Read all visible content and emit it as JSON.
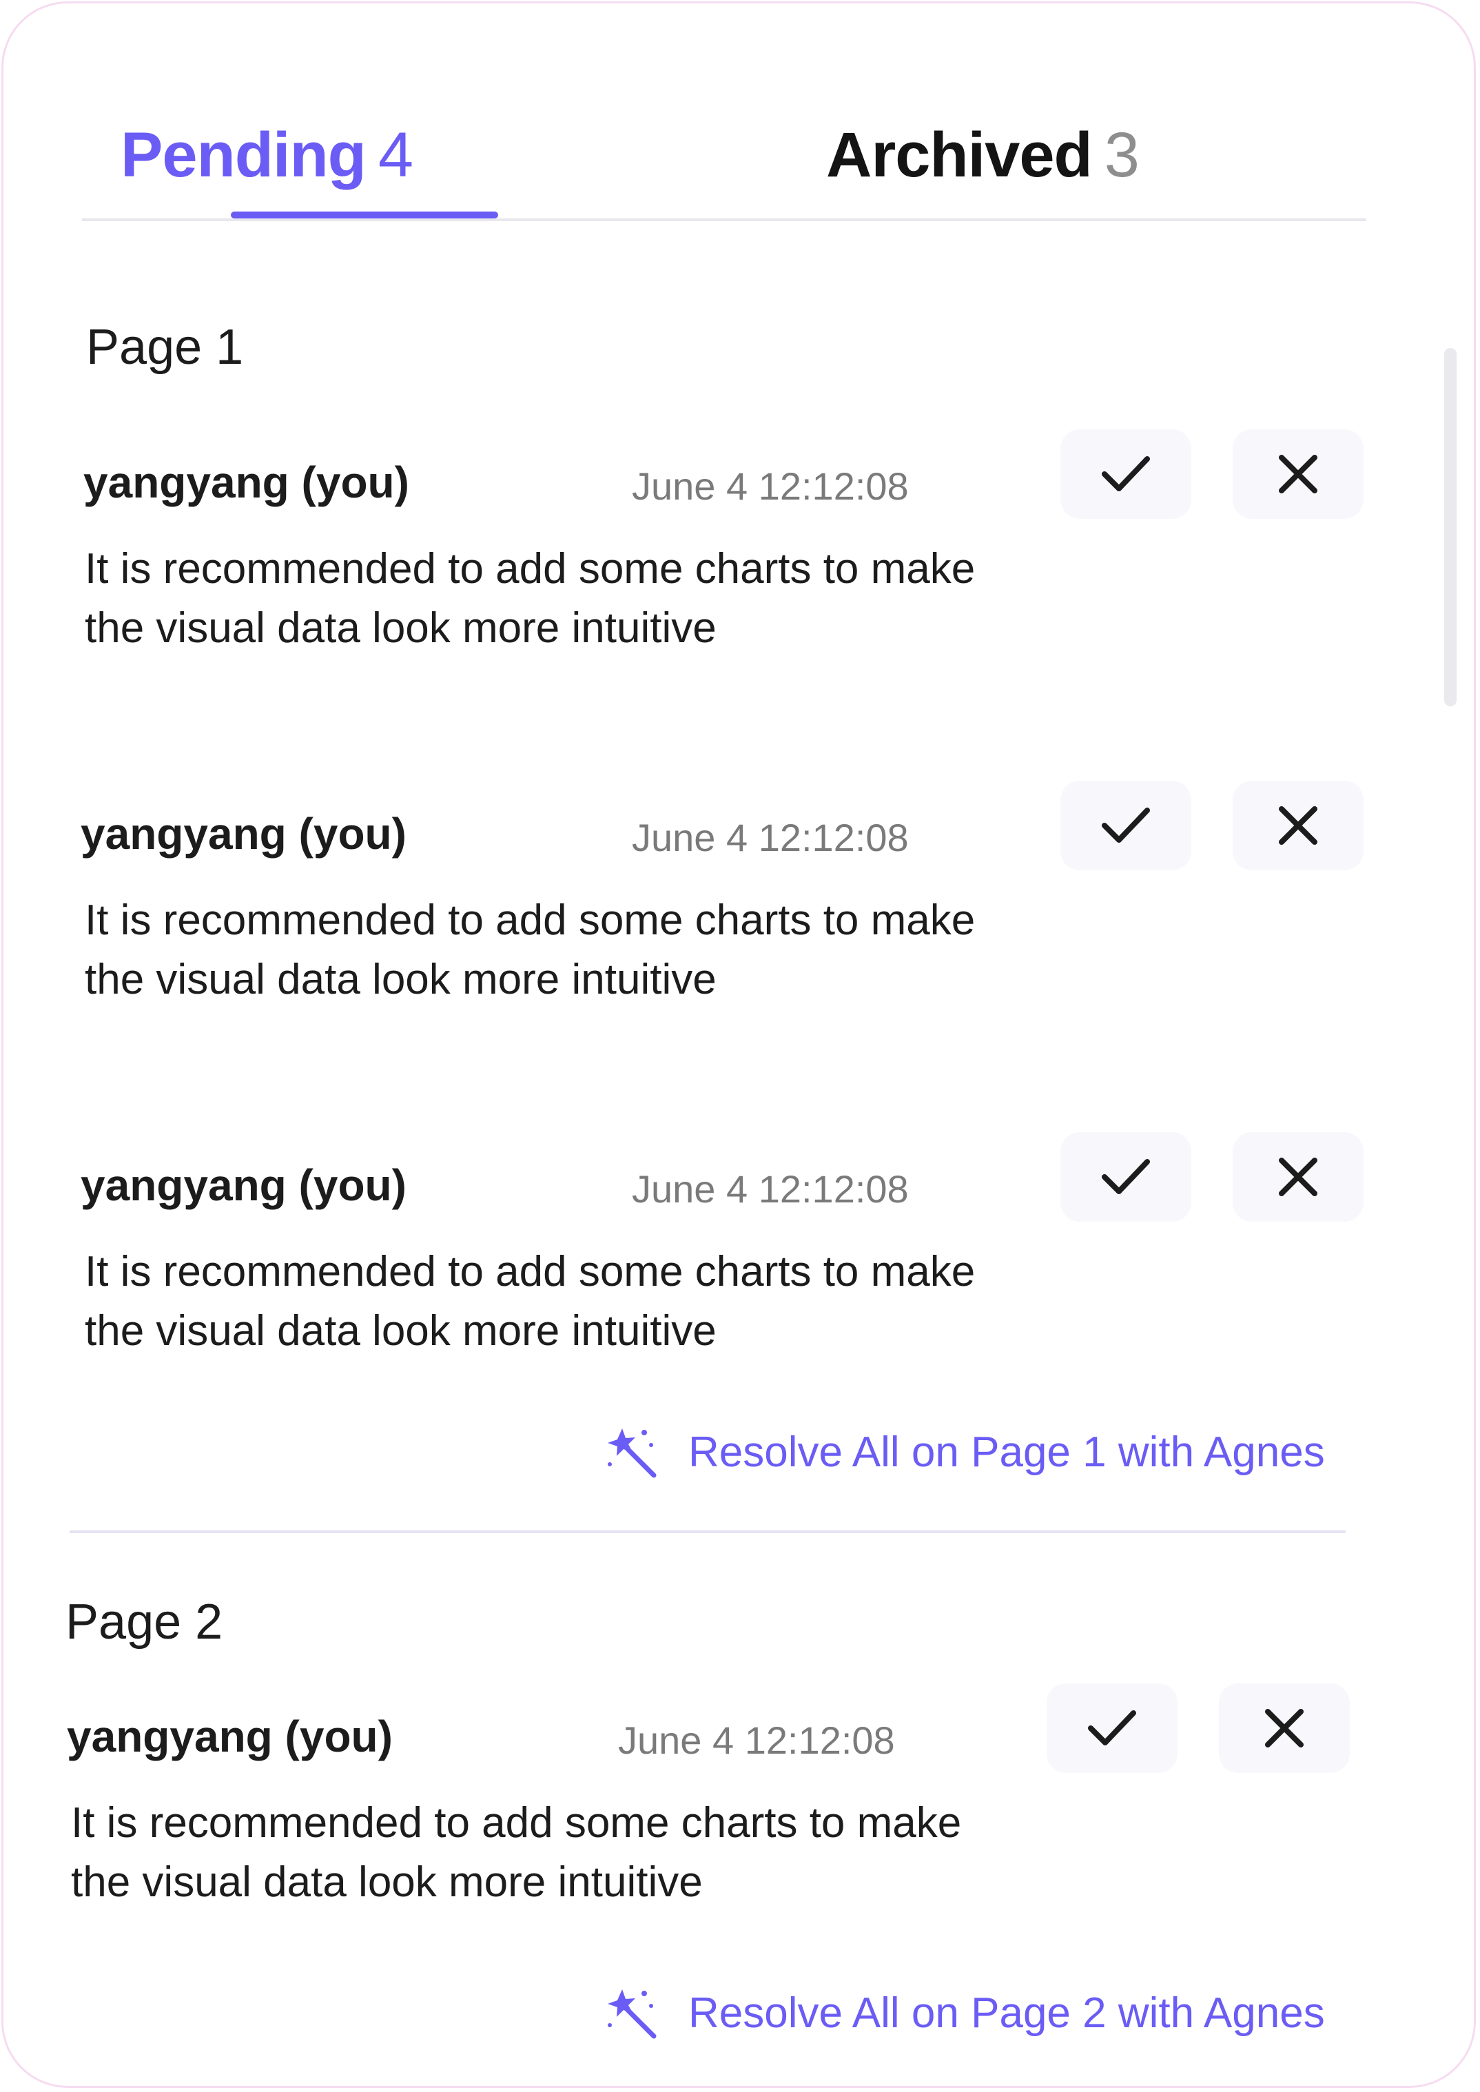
{
  "tabs": [
    {
      "label": "Pending",
      "count": "4",
      "active": true
    },
    {
      "label": "Archived",
      "count": "3",
      "active": false
    }
  ],
  "pages": [
    {
      "title": "Page 1",
      "resolve_label": "Resolve All on Page 1 with Agnes",
      "comments": [
        {
          "author": "yangyang (you)",
          "time": "June 4 12:12:08",
          "text": "It is recommended to add some charts to make the visual data look more intuitive"
        },
        {
          "author": "yangyang (you)",
          "time": "June 4 12:12:08",
          "text": "It is recommended to add some charts to make the visual data look more intuitive"
        },
        {
          "author": "yangyang (you)",
          "time": "June 4 12:12:08",
          "text": "It is recommended to add some charts to make the visual data look more intuitive"
        }
      ]
    },
    {
      "title": "Page 2",
      "resolve_label": "Resolve All on Page 2 with Agnes",
      "comments": [
        {
          "author": "yangyang (you)",
          "time": "June 4 12:12:08",
          "text": "It is recommended to add some charts to make the visual data look more intuitive"
        }
      ]
    }
  ],
  "icons": {
    "accept": "check-icon",
    "reject": "close-icon",
    "resolve": "magic-wand-icon"
  },
  "colors": {
    "accent": "#6a5cf4",
    "text": "#1c1c1c",
    "muted": "#7a7a7a",
    "button_bg": "#f8f7fc"
  }
}
